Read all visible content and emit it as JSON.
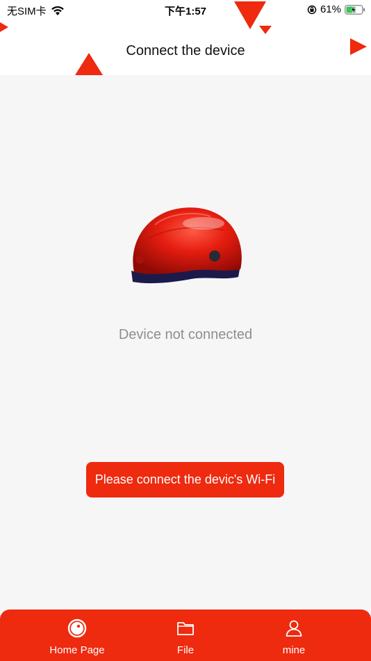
{
  "status_bar": {
    "carrier": "无SIM卡",
    "time": "下午1:57",
    "battery_percent": "61%",
    "battery_level": 0.61
  },
  "header": {
    "title": "Connect the device"
  },
  "main": {
    "device_image": "red-helmet",
    "status_text": "Device not connected",
    "connect_button_label": "Please connect the devic's Wi-Fi"
  },
  "tab_bar": {
    "tabs": [
      {
        "label": "Home Page",
        "icon": "home-target-icon",
        "active": true
      },
      {
        "label": "File",
        "icon": "folder-icon",
        "active": false
      },
      {
        "label": "mine",
        "icon": "person-icon",
        "active": false
      }
    ]
  },
  "colors": {
    "accent": "#ee2a0f",
    "background": "#f6f6f6",
    "header_bg": "#ffffff",
    "status_text": "#8e8e8e"
  }
}
